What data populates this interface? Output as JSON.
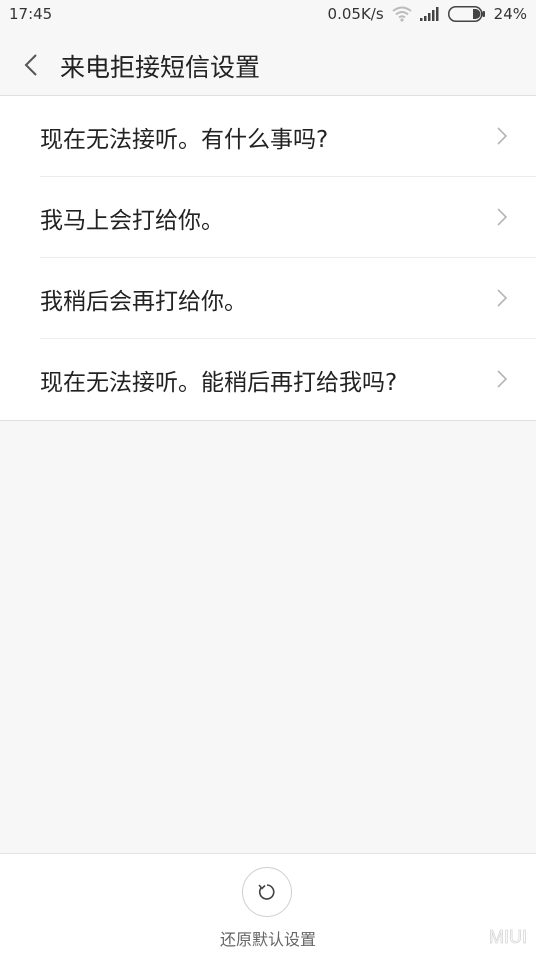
{
  "status_bar": {
    "time": "17:45",
    "network_speed": "0.05K/s",
    "battery": "24%",
    "icons": [
      "wifi-icon",
      "signal-icon",
      "battery-icon"
    ]
  },
  "header": {
    "back_icon": "chevron-left-icon",
    "title": "来电拒接短信设置"
  },
  "messages": [
    {
      "label": "现在无法接听。有什么事吗?"
    },
    {
      "label": "我马上会打给你。"
    },
    {
      "label": "我稍后会再打给你。"
    },
    {
      "label": "现在无法接听。能稍后再打给我吗?"
    }
  ],
  "bottom": {
    "reset_icon": "refresh-icon",
    "reset_label": "还原默认设置",
    "logo_text": "MIUI"
  },
  "colors": {
    "background": "#f7f7f7",
    "surface": "#ffffff",
    "text": "#222222",
    "chevron": "#b5b5b5"
  }
}
